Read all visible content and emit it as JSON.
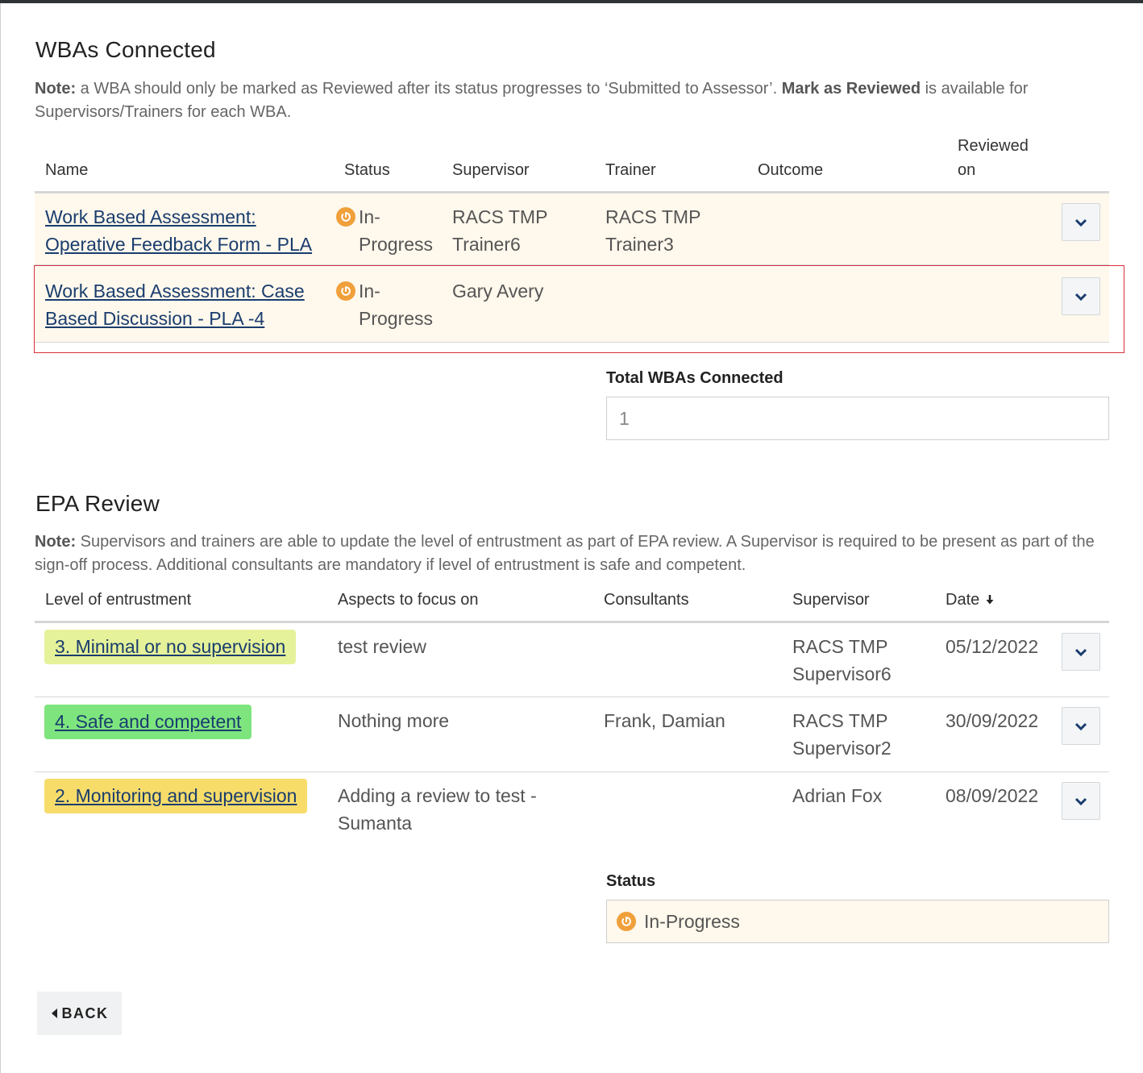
{
  "wba": {
    "title": "WBAs Connected",
    "note_label": "Note:",
    "note_text1": " a WBA should only be marked as Reviewed after its status progresses to ‘Submitted to Assessor’. ",
    "note_bold": "Mark as Reviewed",
    "note_text2": " is available for Supervisors/Trainers for each WBA.",
    "headers": {
      "name": "Name",
      "status": "Status",
      "supervisor": "Supervisor",
      "trainer": "Trainer",
      "outcome": "Outcome",
      "reviewed_on_1": "Reviewed",
      "reviewed_on_2": "on"
    },
    "rows": [
      {
        "name_1": "Work Based Assessment:",
        "name_2": "Operative Feedback Form - PLA",
        "status_1": "In-",
        "status_2": "Progress",
        "supervisor_1": "RACS TMP",
        "supervisor_2": "Trainer6",
        "trainer_1": "RACS TMP",
        "trainer_2": "Trainer3",
        "outcome": "",
        "reviewed_on": ""
      },
      {
        "name_1": "Work Based Assessment: Case",
        "name_2": "Based Discussion - PLA -4",
        "status_1": "In-",
        "status_2": "Progress",
        "supervisor_1": "Gary Avery",
        "supervisor_2": "",
        "trainer_1": "",
        "trainer_2": "",
        "outcome": "",
        "reviewed_on": ""
      }
    ],
    "total_label": "Total WBAs Connected",
    "total_value": "1"
  },
  "epa": {
    "title": "EPA Review",
    "note_label": "Note:",
    "note_text": " Supervisors and trainers are able to update the level of entrustment as part of EPA review. A Supervisor is required to be present as part of the sign-off process. Additional consultants are mandatory if level of entrustment is safe and competent.",
    "headers": {
      "level": "Level of entrustment",
      "aspects": "Aspects to focus on",
      "consultants": "Consultants",
      "supervisor": "Supervisor",
      "date": "Date"
    },
    "rows": [
      {
        "level": "3. Minimal or no supervision",
        "level_color": "#e6f29a",
        "aspects_1": "test review",
        "aspects_2": "",
        "consultants": "",
        "supervisor_1": "RACS TMP",
        "supervisor_2": "Supervisor6",
        "date": "05/12/2022"
      },
      {
        "level": "4. Safe and competent",
        "level_color": "#7ee57e",
        "aspects_1": "Nothing more",
        "aspects_2": "",
        "consultants": "Frank, Damian",
        "supervisor_1": "RACS TMP",
        "supervisor_2": "Supervisor2",
        "date": "30/09/2022"
      },
      {
        "level": "2. Monitoring and supervision",
        "level_color": "#f7dc6a",
        "aspects_1": "Adding a review to test -",
        "aspects_2": "Sumanta",
        "consultants": "",
        "supervisor_1": "Adrian Fox",
        "supervisor_2": "",
        "date": "08/09/2022"
      }
    ],
    "status_label": "Status",
    "status_value": "In-Progress"
  },
  "back_label": "BACK",
  "colors": {
    "accent_orange": "#f0a03a",
    "link_blue": "#1a3d6e",
    "row_highlight": "#fff8ec",
    "selection_border": "#d9303a"
  },
  "icons": {
    "status": "in-progress-icon",
    "expand": "chevron-down-icon",
    "sort": "arrow-down-icon",
    "back": "caret-left-icon"
  }
}
